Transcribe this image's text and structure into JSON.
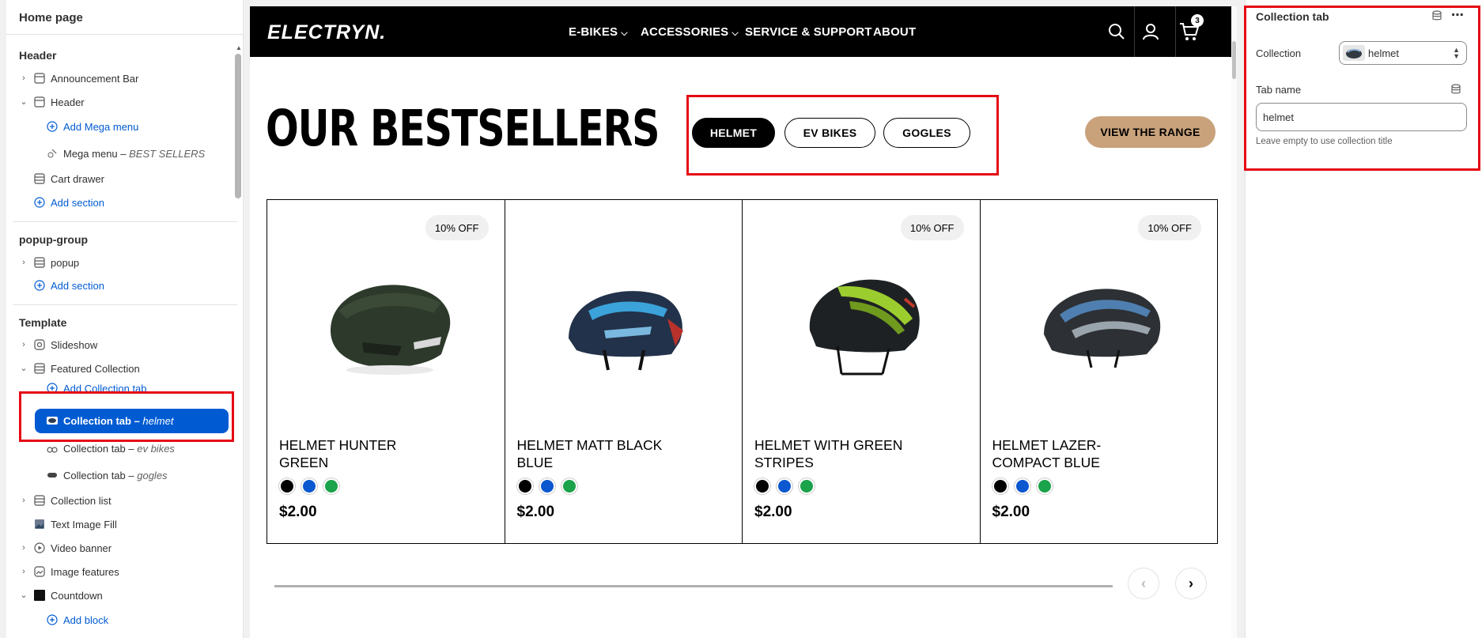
{
  "sidebar": {
    "title": "Home page",
    "header_group": {
      "title": "Header",
      "items": [
        {
          "label": "Announcement Bar",
          "italic": ""
        },
        {
          "label": "Header",
          "italic": ""
        },
        {
          "label": "Add Mega menu",
          "italic": ""
        },
        {
          "label": "Mega menu – ",
          "italic": "BEST SELLERS"
        },
        {
          "label": "Cart drawer",
          "italic": ""
        },
        {
          "label": "Add section",
          "italic": ""
        }
      ]
    },
    "popup_group": {
      "title": "popup-group",
      "items": [
        {
          "label": "popup",
          "italic": ""
        },
        {
          "label": "Add section",
          "italic": ""
        }
      ]
    },
    "template_group": {
      "title": "Template",
      "items": [
        {
          "label": "Slideshow",
          "italic": ""
        },
        {
          "label": "Featured Collection",
          "italic": ""
        },
        {
          "label": "Add Collection tab",
          "italic": ""
        },
        {
          "label": "Collection tab – ",
          "italic": "helmet"
        },
        {
          "label": "Collection tab – ",
          "italic": "ev bikes"
        },
        {
          "label": "Collection tab – ",
          "italic": "gogles"
        },
        {
          "label": "Collection list",
          "italic": ""
        },
        {
          "label": "Text Image Fill",
          "italic": ""
        },
        {
          "label": "Video banner",
          "italic": ""
        },
        {
          "label": "Image features",
          "italic": ""
        },
        {
          "label": "Countdown",
          "italic": ""
        },
        {
          "label": "Add block",
          "italic": ""
        }
      ]
    }
  },
  "preview": {
    "logo": "ELECTRYN.",
    "nav": [
      "E-BIKES",
      "ACCESSORIES",
      "SERVICE & SUPPORT",
      "ABOUT"
    ],
    "cart_count": "3",
    "heading": "OUR BESTSELLERS",
    "tabs": [
      "HELMET",
      "EV BIKES",
      "GOGLES"
    ],
    "range_button": "VIEW THE RANGE",
    "products": [
      {
        "badge": "10% OFF",
        "name": "HELMET HUNTER GREEN",
        "price": "$2.00"
      },
      {
        "badge": "",
        "name": "HELMET MATT BLACK BLUE",
        "price": "$2.00"
      },
      {
        "badge": "10% OFF",
        "name": "HELMET WITH GREEN STRIPES",
        "price": "$2.00"
      },
      {
        "badge": "10% OFF",
        "name": "HELMET LAZER-COMPACT BLUE",
        "price": "$2.00"
      }
    ],
    "swatch_colors": [
      "#000000",
      "#0b57d0",
      "#1aa34a"
    ]
  },
  "right_panel": {
    "title": "Collection tab",
    "collection_label": "Collection",
    "collection_value": "helmet",
    "tab_name_label": "Tab name",
    "tab_name_value": "helmet",
    "help_text": "Leave empty to use collection title"
  },
  "colors": {
    "accent": "#005bd3",
    "highlight": "#e50914",
    "range_button": "#c9a27b"
  }
}
